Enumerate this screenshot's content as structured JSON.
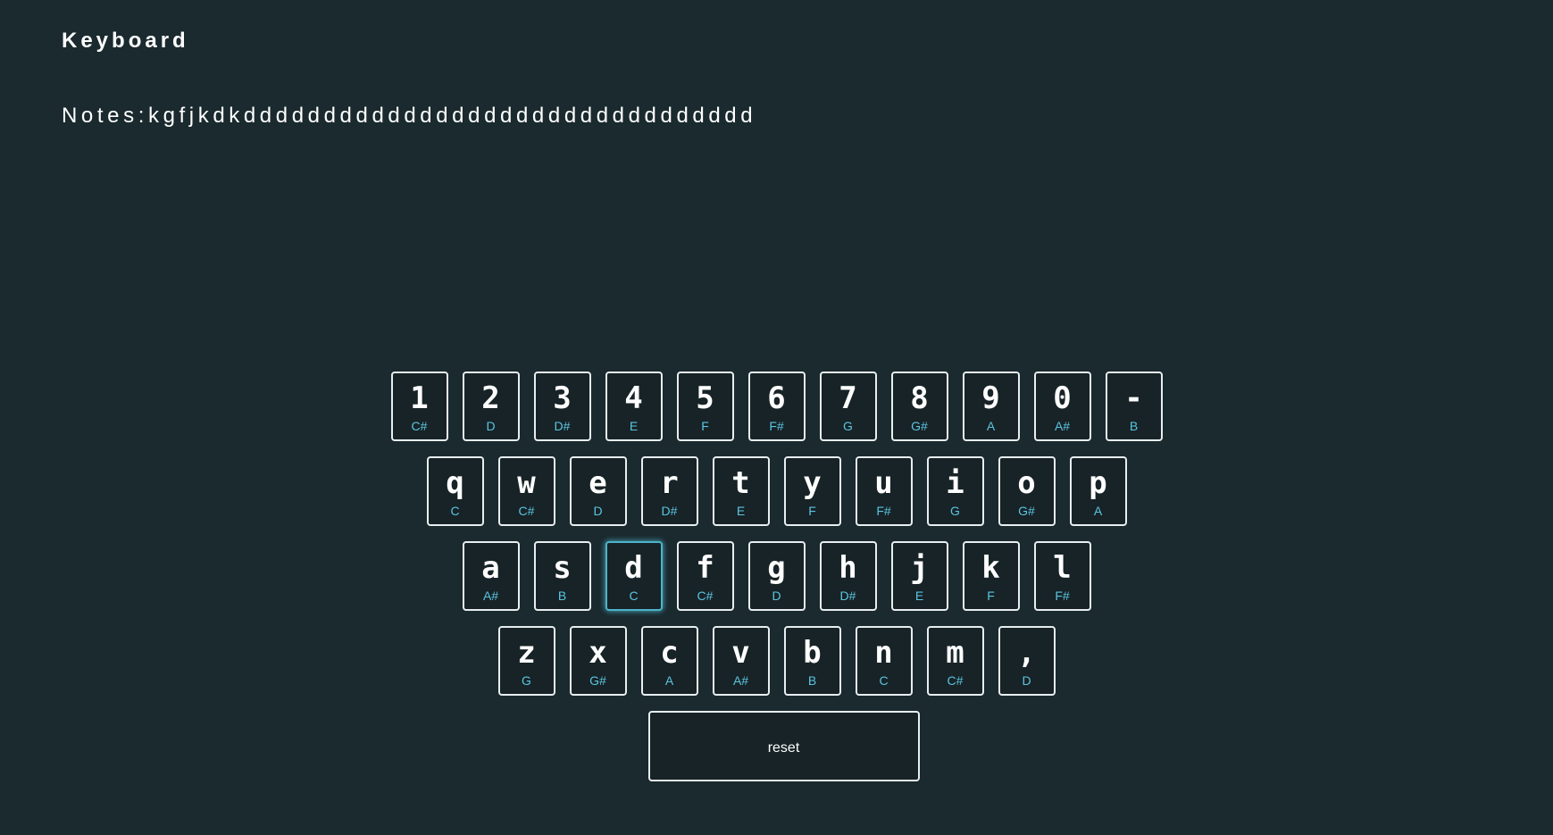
{
  "header": {
    "title": "Keyboard"
  },
  "notes": {
    "label": "Notes:",
    "value": "kgfjkdkdddddddddddddddddddddddddddddddd"
  },
  "keyboard": {
    "rows": [
      [
        {
          "char": "1",
          "note": "C#"
        },
        {
          "char": "2",
          "note": "D"
        },
        {
          "char": "3",
          "note": "D#"
        },
        {
          "char": "4",
          "note": "E"
        },
        {
          "char": "5",
          "note": "F"
        },
        {
          "char": "6",
          "note": "F#"
        },
        {
          "char": "7",
          "note": "G"
        },
        {
          "char": "8",
          "note": "G#"
        },
        {
          "char": "9",
          "note": "A"
        },
        {
          "char": "0",
          "note": "A#"
        },
        {
          "char": "-",
          "note": "B"
        }
      ],
      [
        {
          "char": "q",
          "note": "C"
        },
        {
          "char": "w",
          "note": "C#"
        },
        {
          "char": "e",
          "note": "D"
        },
        {
          "char": "r",
          "note": "D#"
        },
        {
          "char": "t",
          "note": "E"
        },
        {
          "char": "y",
          "note": "F"
        },
        {
          "char": "u",
          "note": "F#"
        },
        {
          "char": "i",
          "note": "G"
        },
        {
          "char": "o",
          "note": "G#"
        },
        {
          "char": "p",
          "note": "A"
        }
      ],
      [
        {
          "char": "a",
          "note": "A#"
        },
        {
          "char": "s",
          "note": "B"
        },
        {
          "char": "d",
          "note": "C",
          "active": true
        },
        {
          "char": "f",
          "note": "C#"
        },
        {
          "char": "g",
          "note": "D"
        },
        {
          "char": "h",
          "note": "D#"
        },
        {
          "char": "j",
          "note": "E"
        },
        {
          "char": "k",
          "note": "F"
        },
        {
          "char": "l",
          "note": "F#"
        }
      ],
      [
        {
          "char": "z",
          "note": "G"
        },
        {
          "char": "x",
          "note": "G#"
        },
        {
          "char": "c",
          "note": "A"
        },
        {
          "char": "v",
          "note": "A#"
        },
        {
          "char": "b",
          "note": "B"
        },
        {
          "char": "n",
          "note": "C"
        },
        {
          "char": "m",
          "note": "C#"
        },
        {
          "char": ",",
          "note": "D"
        }
      ]
    ],
    "reset_label": "reset"
  },
  "colors": {
    "background": "#1a2a2f",
    "key_border": "#e8eef0",
    "note_text": "#5cc4e0",
    "active_glow": "#4fb3c8"
  }
}
